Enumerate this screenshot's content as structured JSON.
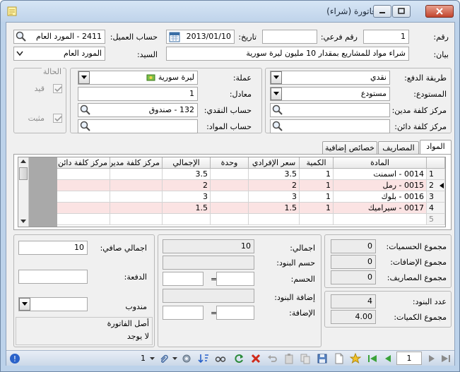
{
  "window": {
    "title": "فاتورة (شراء)"
  },
  "header": {
    "number_label": "رقم:",
    "number_value": "1",
    "subnumber_label": "رقم فرعي:",
    "subnumber_value": "",
    "date_label": "تاريخ:",
    "date_value": "2013/01/10",
    "client_account_label": "حساب العميل:",
    "client_account_value": "2411 - المورد العام",
    "statement_label": "بيان:",
    "statement_value": "شراء مواد  للمشاريع بمقدار 10 مليون ليرة سورية",
    "mr_label": "السيد:",
    "mr_value": "المورد العام"
  },
  "status_panel": {
    "title": "الحالة",
    "recorded_label": "قيد",
    "posted_label": "مثبت"
  },
  "middle": {
    "currency_label": "عملة:",
    "currency_value": "ليرة سورية",
    "rate_label": "معادل:",
    "rate_value": "1",
    "cash_account_label": "حساب النقدي:",
    "cash_account_value": "132 - صندوق",
    "materials_account_label": "حساب المواد:",
    "materials_account_value": ""
  },
  "right_panel": {
    "payment_method_label": "طريقة الدفع:",
    "payment_method_value": "نقدي",
    "warehouse_label": "المستودع:",
    "warehouse_value": "مستودع",
    "debit_center_label": "مركز كلفة مدين:",
    "credit_center_label": "مركز كلفة دائن:"
  },
  "tabs": [
    "المواد",
    "المصاريف",
    "خصائص إضافية"
  ],
  "grid": {
    "headers": [
      "المادة",
      "الكمية",
      "سعر الإفرادي",
      "وحدة",
      "الإجمالي",
      "مركز كلفة مدين",
      "مركز كلفة دائن"
    ],
    "rows": [
      {
        "n": "1",
        "item": "0014 - اسمنت",
        "qty": "1",
        "price": "3.5",
        "unit": "",
        "total": "3.5"
      },
      {
        "n": "2",
        "item": "0015 - رمل",
        "qty": "1",
        "price": "2",
        "unit": "",
        "total": "2"
      },
      {
        "n": "3",
        "item": "0016 - بلوك",
        "qty": "1",
        "price": "3",
        "unit": "",
        "total": "3"
      },
      {
        "n": "4",
        "item": "0017 - سيراميك",
        "qty": "1",
        "price": "1.5",
        "unit": "",
        "total": "1.5"
      },
      {
        "n": "5",
        "item": "",
        "qty": "",
        "price": "",
        "unit": "",
        "total": ""
      }
    ]
  },
  "totals_left": {
    "net_label": "اجمالي صافي:",
    "net_value": "10",
    "payment_label": "الدفعة:",
    "payment_value": "",
    "rep_label": "مندوب",
    "origin_label": "أصل الفاتورة",
    "origin_value": "لا يوجد"
  },
  "totals_mid": {
    "total_label": "اجمالي:",
    "total_value": "10",
    "items_discount_label": "حسم البنود:",
    "discount_label": "الحسم:",
    "eq": "=",
    "items_addition_label": "إضافة البنود:",
    "addition_label": "الإضافة:"
  },
  "totals_right": {
    "discounts_sum_label": "مجموع الحسميات:",
    "discounts_sum_value": "0",
    "additions_sum_label": "مجموع الإضافات:",
    "additions_sum_value": "0",
    "expenses_sum_label": "مجموع المصاريف:",
    "expenses_sum_value": "0",
    "items_count_label": "عدد البنود:",
    "items_count_value": "4",
    "qty_sum_label": "مجموع الكميات:",
    "qty_sum_value": "4.00"
  },
  "toolbar": {
    "page_value": "1",
    "attachments_count": "1"
  }
}
